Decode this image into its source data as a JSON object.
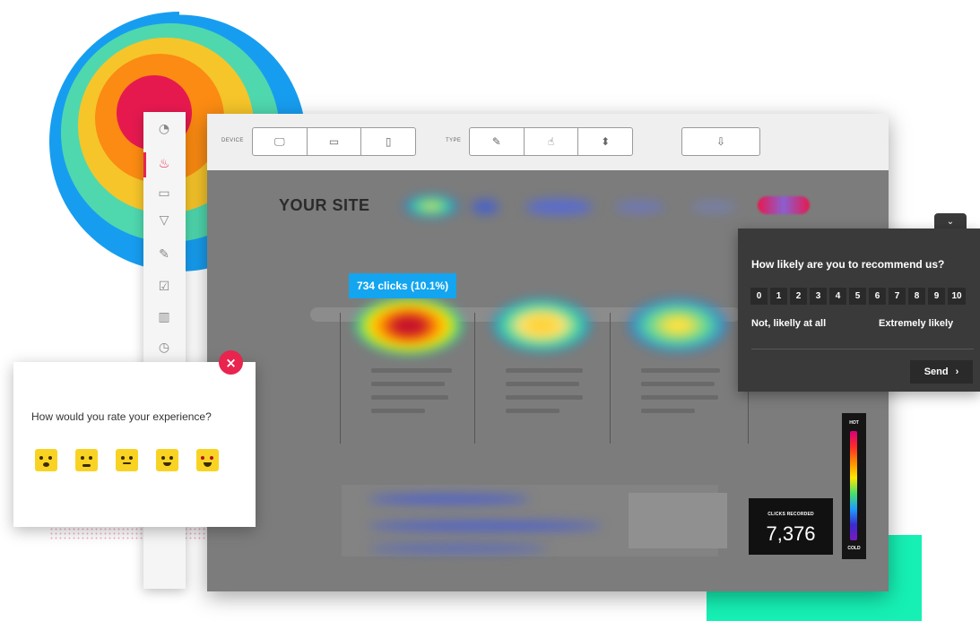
{
  "toolbar": {
    "device_label": "DEVICE",
    "device_buttons": [
      {
        "name": "desktop",
        "glyph": "🖵"
      },
      {
        "name": "tablet",
        "glyph": "▭"
      },
      {
        "name": "mobile",
        "glyph": "▯"
      }
    ],
    "type_label": "TYPE",
    "type_buttons": [
      {
        "name": "clicks",
        "glyph": "✎"
      },
      {
        "name": "move",
        "glyph": "☝"
      },
      {
        "name": "scroll",
        "glyph": "⬍"
      }
    ],
    "download_glyph": "⇩"
  },
  "site": {
    "logo": "YOUR SITE",
    "tooltip": "734 clicks (10.1%)"
  },
  "legend": {
    "hot_label": "HOT",
    "cold_label": "COLD",
    "clicks_recorded_label": "CLICKS RECORDED",
    "clicks_recorded_value": "7,376"
  },
  "nps": {
    "question": "How likely are you to recommend us?",
    "scale": [
      "0",
      "1",
      "2",
      "3",
      "4",
      "5",
      "6",
      "7",
      "8",
      "9",
      "10"
    ],
    "low_label": "Not, likelly at all",
    "high_label": "Extremely likely",
    "send_label": "Send",
    "send_icon": "›",
    "collapse_icon": "⌄"
  },
  "rating": {
    "question": "How would you rate your experience?",
    "close_icon": "×",
    "options": [
      "angry",
      "sad",
      "neutral",
      "happy",
      "love"
    ]
  },
  "sidebar": {
    "icons": [
      "dashboard",
      "heatmap",
      "recordings",
      "funnels",
      "forms",
      "polls",
      "reports",
      "history"
    ]
  },
  "colors": {
    "accent": "#e8244f",
    "tooltip": "#13a5f0",
    "dark_panel": "#3a3a3a",
    "emoji": "#f9d323",
    "green_block": "#16f0b4"
  }
}
